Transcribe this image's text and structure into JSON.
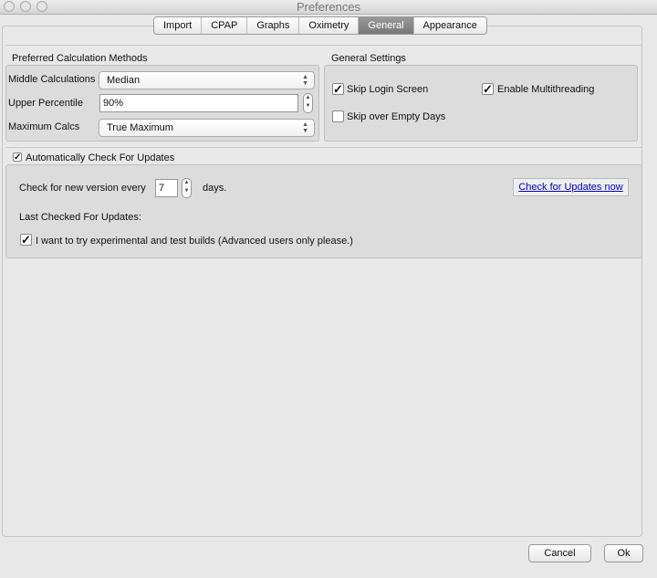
{
  "window": {
    "title": "Preferences"
  },
  "tabs": [
    {
      "label": "Import"
    },
    {
      "label": "CPAP"
    },
    {
      "label": "Graphs"
    },
    {
      "label": "Oximetry"
    },
    {
      "label": "General",
      "active": true
    },
    {
      "label": "Appearance"
    }
  ],
  "calc": {
    "title": "Preferred Calculation Methods",
    "middle_label": "Middle Calculations",
    "middle_value": "Median",
    "upper_label": "Upper Percentile",
    "upper_value": "90%",
    "max_label": "Maximum Calcs",
    "max_value": "True Maximum"
  },
  "general": {
    "title": "General Settings",
    "skip_login": "Skip Login Screen",
    "skip_login_checked": true,
    "multithreading": "Enable Multithreading",
    "multithreading_checked": true,
    "skip_empty": "Skip over Empty Days",
    "skip_empty_checked": false
  },
  "updates": {
    "auto_label": "Automatically Check For Updates",
    "auto_checked": true,
    "check_every": "Check for new version every",
    "days_value": "7",
    "days_label": "days.",
    "check_now": "Check for Updates now",
    "last_checked": "Last Checked For Updates:",
    "experimental": "I want to try experimental and test builds (Advanced users only please.)",
    "experimental_checked": true
  },
  "footer": {
    "cancel": "Cancel",
    "ok": "Ok"
  }
}
